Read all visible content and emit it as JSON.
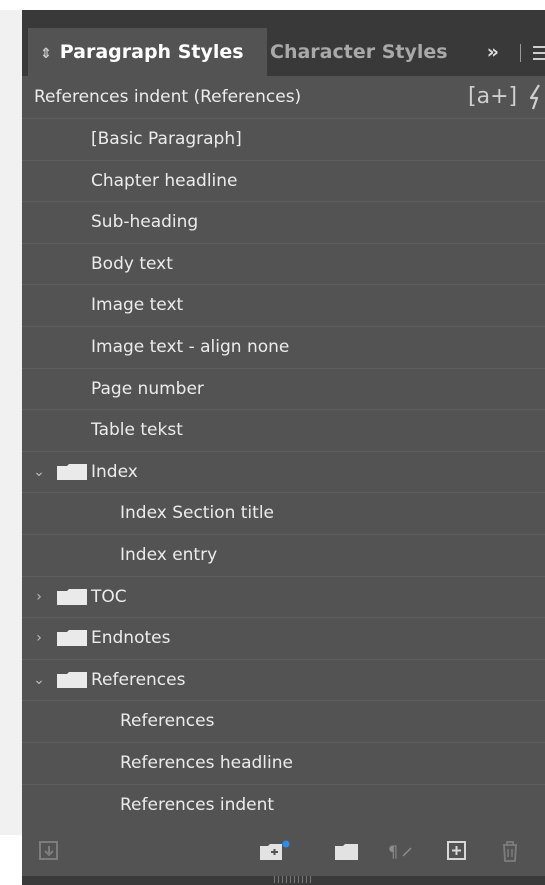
{
  "tabs": {
    "active_label": "Paragraph Styles",
    "inactive_label": "Character Styles",
    "overflow_label": "»"
  },
  "header": {
    "title": "References indent (References)",
    "shortcut_icon_label": "[a+]"
  },
  "styles": [
    {
      "label": "[Basic Paragraph]"
    },
    {
      "label": "Chapter headline"
    },
    {
      "label": "Sub-heading"
    },
    {
      "label": "Body text"
    },
    {
      "label": "Image text"
    },
    {
      "label": "Image text - align none"
    },
    {
      "label": "Page number"
    },
    {
      "label": "Table tekst"
    }
  ],
  "groups": {
    "index": {
      "label": "Index",
      "expanded": true,
      "items": [
        "Index Section title",
        "Index entry"
      ]
    },
    "toc": {
      "label": "TOC",
      "expanded": false
    },
    "endnotes": {
      "label": "Endnotes",
      "expanded": false
    },
    "references": {
      "label": "References",
      "expanded": true,
      "items": [
        "References",
        "References headline",
        "References indent"
      ]
    }
  },
  "colors": {
    "panel_bg": "#535353",
    "tabbar_bg": "#393939",
    "text": "#ececec",
    "muted_text": "#a9a9a9",
    "accent_dot": "#2d8ceb"
  },
  "footer_icons": [
    "load-styles-icon",
    "new-group-with-badge-icon",
    "folder-icon",
    "clear-overrides-icon",
    "new-style-icon",
    "trash-icon"
  ]
}
